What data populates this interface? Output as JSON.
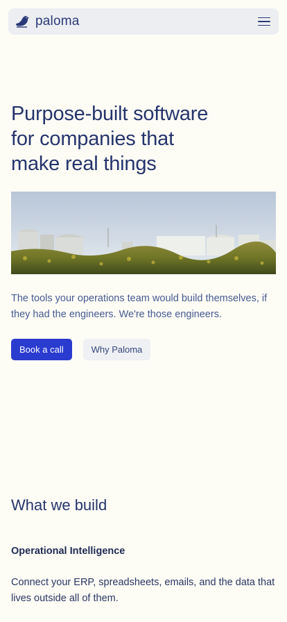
{
  "nav": {
    "brand_name": "paloma",
    "logo_icon": "pigeon-logo-icon",
    "menu_icon": "hamburger-menu-icon"
  },
  "hero": {
    "title_lines": [
      "Purpose-built software",
      "for companies that",
      "make real things"
    ],
    "image_description_icon": "industrial-facility-image",
    "subtitle": "The tools your operations team would build themselves, if they had the engineers. We're those engineers.",
    "primary_cta": "Book a call",
    "secondary_cta": "Why Paloma"
  },
  "section": {
    "title": "What we build",
    "feature_title": "Operational Intelligence",
    "feature_desc": "Connect your ERP, spreadsheets, emails, and the data that lives outside all of them."
  },
  "colors": {
    "background": "#fdfdf6",
    "navbar": "#eceef2",
    "heading": "#25346b",
    "primary_button": "#2a3bcf",
    "secondary_button": "#eff0f3"
  }
}
